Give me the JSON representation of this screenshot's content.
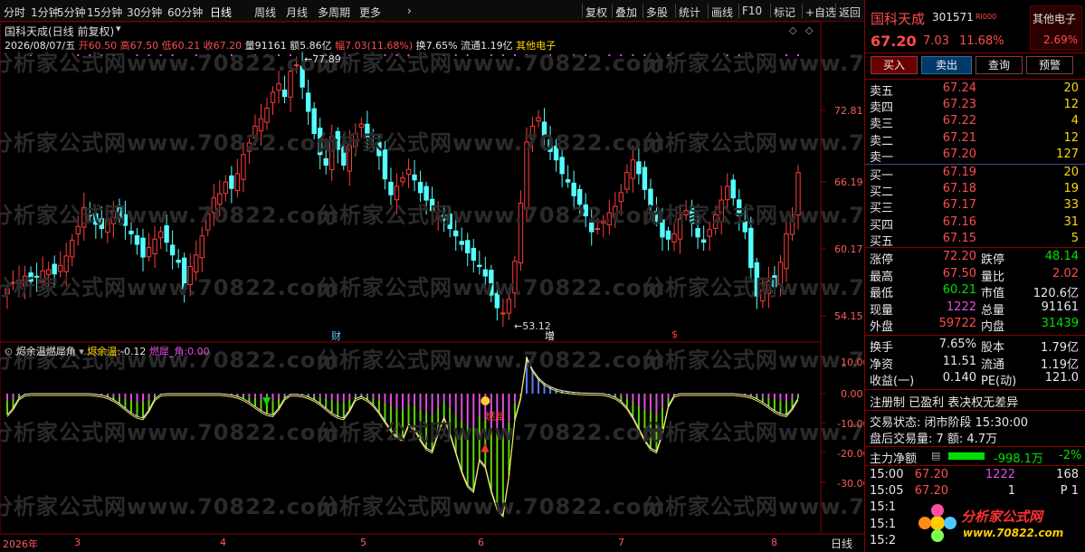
{
  "toolbar": {
    "periods": [
      "分时",
      "1分钟",
      "5分钟",
      "15分钟",
      "30分钟",
      "60分钟",
      "日线",
      "周线",
      "月线",
      "多周期",
      "更多"
    ],
    "actions": [
      "复权",
      "叠加",
      "多股",
      "统计",
      "画线",
      "F10",
      "标记",
      "+自选",
      "返回"
    ]
  },
  "header": {
    "title": "国科天成(日线 前复权)",
    "date": "2026/08/07/五",
    "open_label": "开",
    "open": "60.50",
    "high_label": "高",
    "high": "67.50",
    "low_label": "低",
    "low": "60.21",
    "close_label": "收",
    "close": "67.20",
    "vol_label": "量",
    "vol": "91161",
    "amount_label": "额",
    "amount": "5.86亿",
    "change_label": "幅",
    "change": "7.03(11.68%)",
    "turnover_label": "换",
    "turnover": "7.65%",
    "float_label": "流通",
    "float": "1.19亿",
    "sector": "其他电子"
  },
  "main_chart": {
    "y_labels": [
      "72.81",
      "66.19",
      "60.17",
      "54.15"
    ],
    "high_marker": "77.89",
    "low_marker": "53.12",
    "event_marks": [
      "财",
      "增",
      "$"
    ]
  },
  "indicator": {
    "name": "烬余温燃犀角",
    "series1_label": "烬余温:",
    "series1_value": "-0.12",
    "series2_label": "燃犀_角:",
    "series2_value": "0.00",
    "y_labels": [
      "10.00",
      "0.00",
      "-10.00",
      "-20.00",
      "-30.00"
    ],
    "mark_text": "燃犀"
  },
  "x_axis": {
    "labels": [
      "2026年",
      "3",
      "4",
      "5",
      "6",
      "7",
      "8"
    ],
    "period_label": "日线"
  },
  "watermark": "分析家公式网www.70822.com",
  "quote": {
    "name": "国科天成",
    "code": "301571",
    "rating": "RI000",
    "sector_badge": "其他电子",
    "price": "67.20",
    "change": "7.03",
    "change_pct": "11.68%",
    "badge_pct": "2.69%",
    "buttons": [
      "买入",
      "卖出",
      "查询",
      "预警"
    ],
    "asks": [
      {
        "label": "卖五",
        "price": "67.24",
        "vol": "20"
      },
      {
        "label": "卖四",
        "price": "67.23",
        "vol": "12"
      },
      {
        "label": "卖三",
        "price": "67.22",
        "vol": "4"
      },
      {
        "label": "卖二",
        "price": "67.21",
        "vol": "12"
      },
      {
        "label": "卖一",
        "price": "67.20",
        "vol": "127"
      }
    ],
    "bids": [
      {
        "label": "买一",
        "price": "67.19",
        "vol": "20"
      },
      {
        "label": "买二",
        "price": "67.18",
        "vol": "19"
      },
      {
        "label": "买三",
        "price": "67.17",
        "vol": "33"
      },
      {
        "label": "买四",
        "price": "67.16",
        "vol": "31"
      },
      {
        "label": "买五",
        "price": "67.15",
        "vol": "5"
      }
    ],
    "stats1": [
      {
        "l1": "涨停",
        "v1": "72.20",
        "l2": "跌停",
        "v2": "48.14"
      },
      {
        "l1": "最高",
        "v1": "67.50",
        "l2": "量比",
        "v2": "2.02"
      },
      {
        "l1": "最低",
        "v1": "60.21",
        "l2": "市值",
        "v2": "120.6亿"
      },
      {
        "l1": "现量",
        "v1": "1222",
        "l2": "总量",
        "v2": "91161"
      },
      {
        "l1": "外盘",
        "v1": "59722",
        "l2": "内盘",
        "v2": "31439"
      }
    ],
    "stats2": [
      {
        "l1": "换手",
        "v1": "7.65%",
        "l2": "股本",
        "v2": "1.79亿"
      },
      {
        "l1": "净资",
        "v1": "11.51",
        "l2": "流通",
        "v2": "1.19亿"
      },
      {
        "l1": "收益(一)",
        "v1": "0.140",
        "l2": "PE(动)",
        "v2": "121.0"
      }
    ],
    "reg_text": "注册制 已盈利 表决权无差异",
    "trade_status": "交易状态: 闭市阶段 15:30:00",
    "after_hours": "盘后交易量: 7  额: 4.7万",
    "main_flow_label": "主力净额",
    "main_flow_value": "-998.1万",
    "main_flow_pct": "-2%",
    "ticks": [
      {
        "time": "15:00",
        "price": "67.20",
        "vol": "1222",
        "extra": "168"
      },
      {
        "time": "15:05",
        "price": "67.20",
        "vol": "1",
        "extra": "P 1"
      },
      {
        "time": "15:1",
        "price": "",
        "vol": "",
        "extra": ""
      },
      {
        "time": "15:1",
        "price": "",
        "vol": "",
        "extra": ""
      },
      {
        "time": "15:2",
        "price": "",
        "vol": "",
        "extra": ""
      }
    ],
    "logo_text": "分析家公式网",
    "logo_url": "www.70822.com"
  },
  "colors": {
    "up": "#ff3c3c",
    "down": "#54ffff",
    "grid": "#8b0000",
    "magenta": "#e24be2",
    "green_bar": "#5fd400"
  }
}
